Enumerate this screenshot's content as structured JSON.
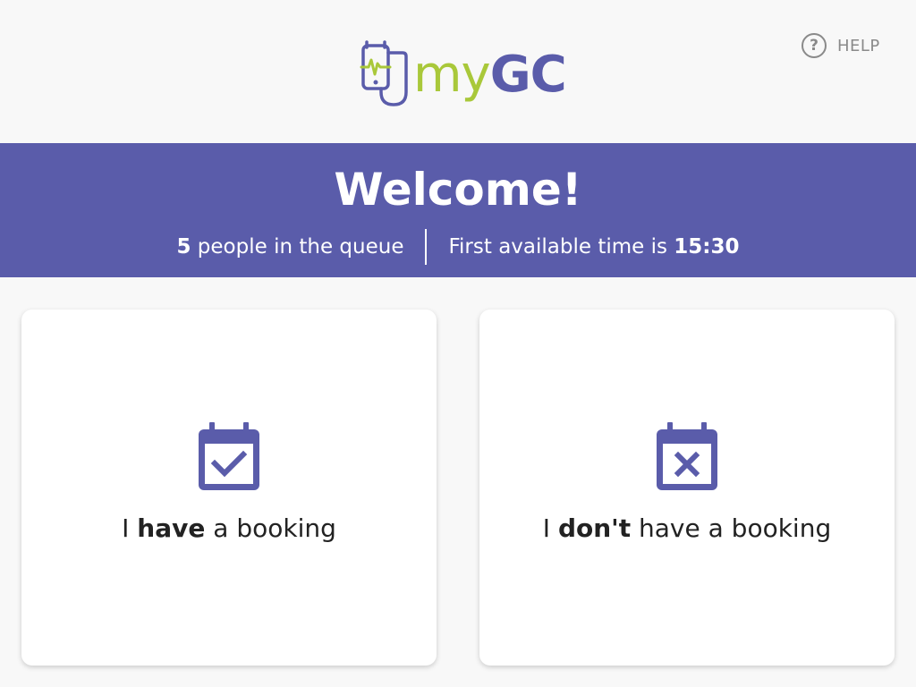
{
  "header": {
    "logo": {
      "prefix": "my",
      "brand": "GC",
      "icon": "phone-stethoscope-icon"
    },
    "help": {
      "icon": "question-circle-icon",
      "icon_glyph": "?",
      "label": "HELP"
    }
  },
  "banner": {
    "title": "Welcome!",
    "queue": {
      "count": "5",
      "text": " people in the queue"
    },
    "first_available": {
      "text": "First available time is ",
      "time": "15:30"
    }
  },
  "cards": {
    "have_booking": {
      "icon": "calendar-check-icon",
      "label_prefix": "I ",
      "label_bold": "have",
      "label_suffix": " a booking"
    },
    "no_booking": {
      "icon": "calendar-x-icon",
      "label_prefix": "I ",
      "label_bold": "don't",
      "label_suffix": " have a booking"
    }
  },
  "colors": {
    "brand_purple": "#5a5caa",
    "brand_green": "#a9c83a",
    "muted_gray": "#8a8a8a",
    "background": "#f8f8f8"
  }
}
